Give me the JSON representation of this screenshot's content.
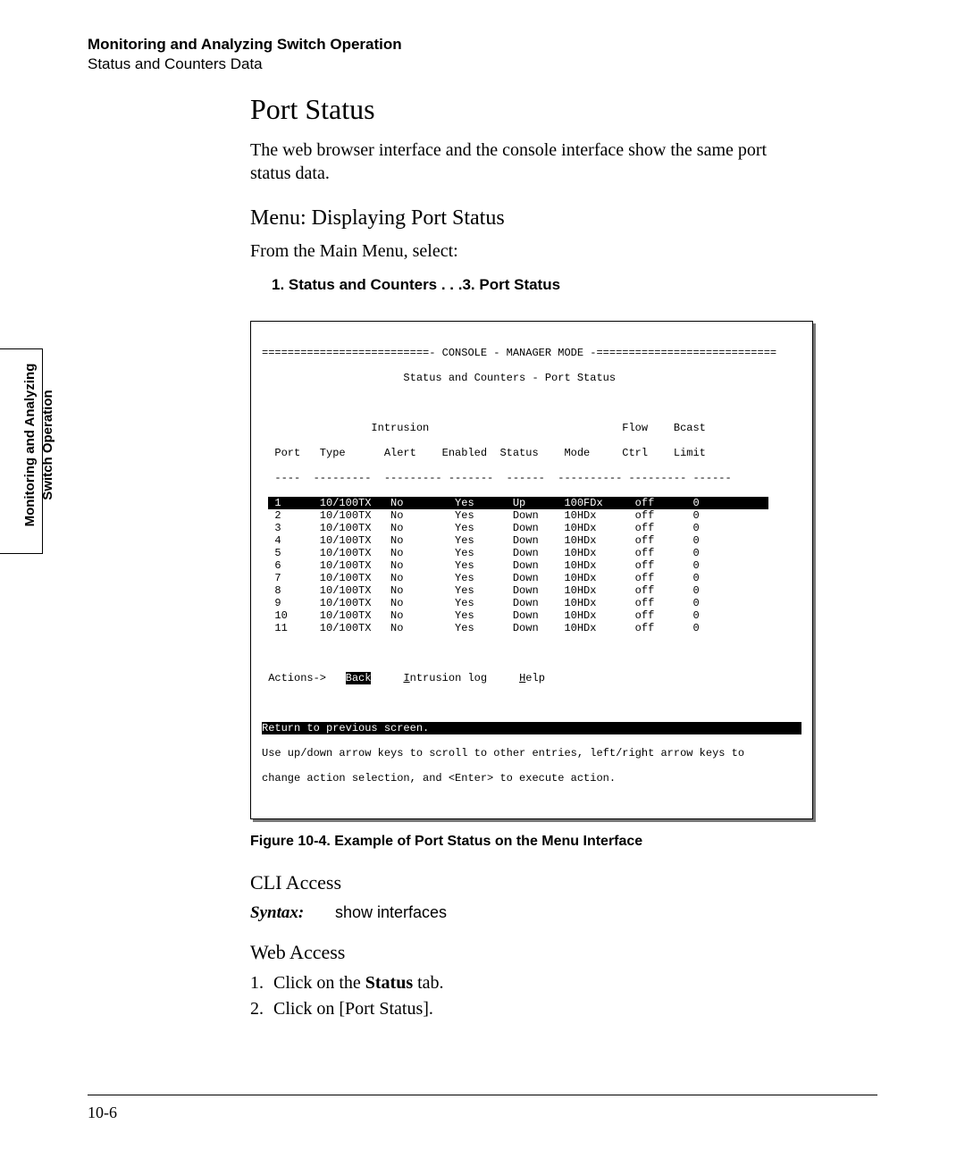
{
  "running_head": {
    "title": "Monitoring and Analyzing Switch Operation",
    "subtitle": "Status and Counters Data"
  },
  "side_tab": {
    "line1": "Monitoring and Analyzing",
    "line2": "Switch Operation"
  },
  "section": {
    "title": "Port Status",
    "intro": "The web browser interface and the console interface show the same port status data."
  },
  "menu": {
    "heading": "Menu: Displaying Port Status",
    "instruction": "From the Main Menu, select:",
    "path": "1. Status and Counters . . .3. Port Status"
  },
  "console": {
    "border_line": "==========================- CONSOLE - MANAGER MODE -============================",
    "screen_title": "                      Status and Counters - Port Status",
    "blank": " ",
    "hdr1": "                 Intrusion                              Flow    Bcast",
    "hdr2": "  Port   Type      Alert    Enabled  Status    Mode     Ctrl    Limit",
    "hdr3": "  ----  ---------  --------- -------  ------  ---------- --------- ------",
    "rows": [
      {
        "sel": true,
        "text": " 1      10/100TX   No        Yes      Up      100FDx     off      0     "
      },
      {
        "sel": false,
        "text": "  2      10/100TX   No        Yes      Down    10HDx      off      0"
      },
      {
        "sel": false,
        "text": "  3      10/100TX   No        Yes      Down    10HDx      off      0"
      },
      {
        "sel": false,
        "text": "  4      10/100TX   No        Yes      Down    10HDx      off      0"
      },
      {
        "sel": false,
        "text": "  5      10/100TX   No        Yes      Down    10HDx      off      0"
      },
      {
        "sel": false,
        "text": "  6      10/100TX   No        Yes      Down    10HDx      off      0"
      },
      {
        "sel": false,
        "text": "  7      10/100TX   No        Yes      Down    10HDx      off      0"
      },
      {
        "sel": false,
        "text": "  8      10/100TX   No        Yes      Down    10HDx      off      0"
      },
      {
        "sel": false,
        "text": "  9      10/100TX   No        Yes      Down    10HDx      off      0"
      },
      {
        "sel": false,
        "text": "  10     10/100TX   No        Yes      Down    10HDx      off      0"
      },
      {
        "sel": false,
        "text": "  11     10/100TX   No        Yes      Down    10HDx      off      0"
      }
    ],
    "actions_prefix": " Actions->   ",
    "action_back": "Back",
    "action_intrusion_pre": "     ",
    "action_intrusion_u": "I",
    "action_intrusion_rest": "ntrusion log",
    "action_help_pre": "     ",
    "action_help_u": "H",
    "action_help_rest": "elp",
    "status_line": "Return to previous screen.",
    "help1": "Use up/down arrow keys to scroll to other entries, left/right arrow keys to",
    "help2": "change action selection, and <Enter> to execute action."
  },
  "figure_caption": "Figure 10-4.  Example of Port Status on the Menu Interface",
  "cli": {
    "heading": "CLI Access",
    "syntax_label": "Syntax:",
    "syntax_cmd": "show interfaces"
  },
  "web": {
    "heading": "Web Access",
    "steps": [
      {
        "pre": "Click on the ",
        "bold": "Status",
        "post": " tab."
      },
      {
        "pre": "Click on [Port Status].",
        "bold": "",
        "post": ""
      }
    ]
  },
  "page_number": "10-6",
  "chart_data": {
    "type": "table",
    "title": "Status and Counters - Port Status",
    "columns": [
      "Port",
      "Type",
      "Intrusion Alert",
      "Enabled",
      "Status",
      "Mode",
      "Flow Ctrl",
      "Bcast Limit"
    ],
    "rows": [
      [
        "1",
        "10/100TX",
        "No",
        "Yes",
        "Up",
        "100FDx",
        "off",
        "0"
      ],
      [
        "2",
        "10/100TX",
        "No",
        "Yes",
        "Down",
        "10HDx",
        "off",
        "0"
      ],
      [
        "3",
        "10/100TX",
        "No",
        "Yes",
        "Down",
        "10HDx",
        "off",
        "0"
      ],
      [
        "4",
        "10/100TX",
        "No",
        "Yes",
        "Down",
        "10HDx",
        "off",
        "0"
      ],
      [
        "5",
        "10/100TX",
        "No",
        "Yes",
        "Down",
        "10HDx",
        "off",
        "0"
      ],
      [
        "6",
        "10/100TX",
        "No",
        "Yes",
        "Down",
        "10HDx",
        "off",
        "0"
      ],
      [
        "7",
        "10/100TX",
        "No",
        "Yes",
        "Down",
        "10HDx",
        "off",
        "0"
      ],
      [
        "8",
        "10/100TX",
        "No",
        "Yes",
        "Down",
        "10HDx",
        "off",
        "0"
      ],
      [
        "9",
        "10/100TX",
        "No",
        "Yes",
        "Down",
        "10HDx",
        "off",
        "0"
      ],
      [
        "10",
        "10/100TX",
        "No",
        "Yes",
        "Down",
        "10HDx",
        "off",
        "0"
      ],
      [
        "11",
        "10/100TX",
        "No",
        "Yes",
        "Down",
        "10HDx",
        "off",
        "0"
      ]
    ]
  }
}
